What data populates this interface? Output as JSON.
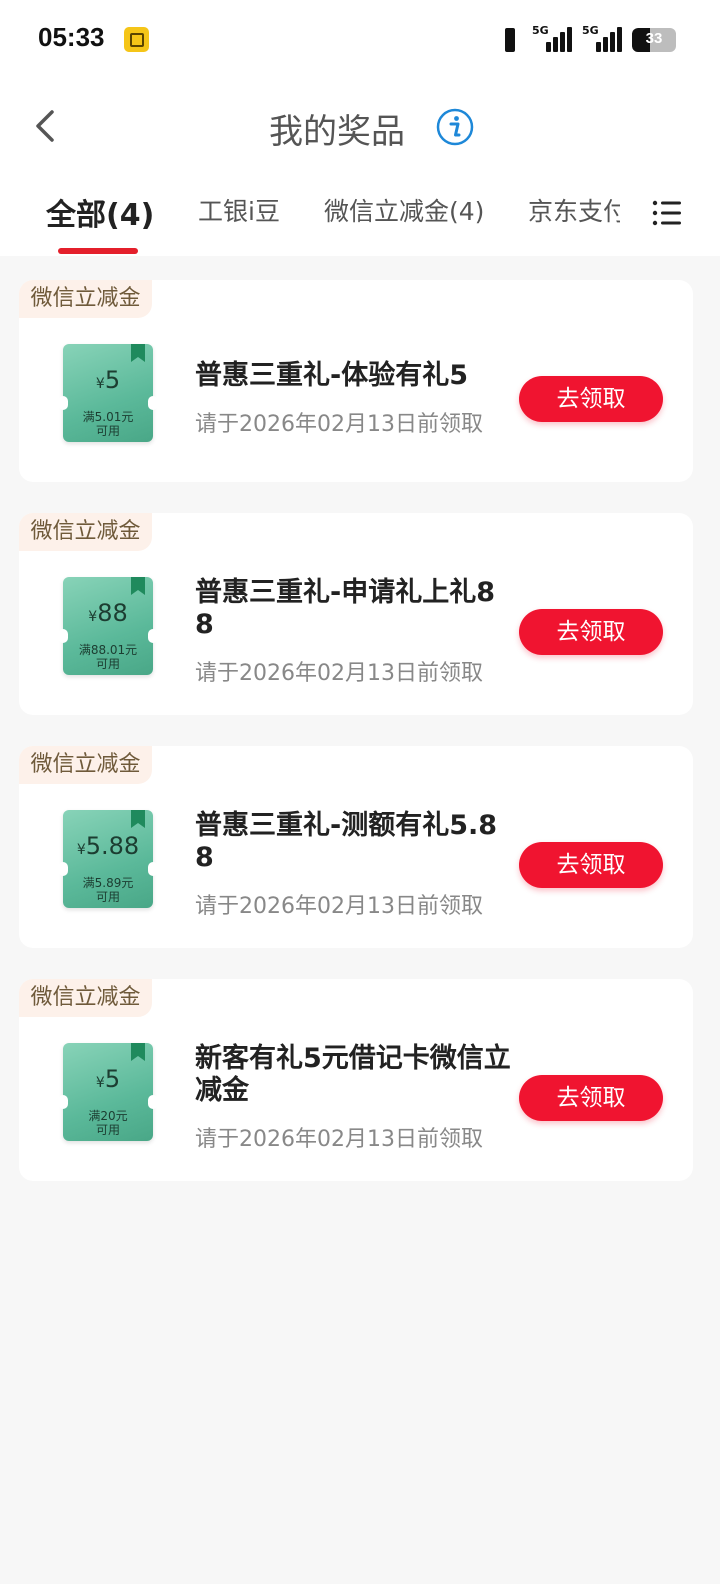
{
  "status_bar": {
    "time": "05:33",
    "network_1": "5G",
    "network_2": "5G",
    "battery_level": "33"
  },
  "header": {
    "title": "我的奖品"
  },
  "tabs": [
    {
      "label": "全部(4)",
      "active": true
    },
    {
      "label": "工银i豆",
      "active": false
    },
    {
      "label": "微信立减金(4)",
      "active": false
    },
    {
      "label": "京东支付",
      "active": false
    }
  ],
  "prizes": [
    {
      "tag": "微信立减金",
      "currency": "¥",
      "amount": "5",
      "condition_line1": "满5.01元",
      "condition_line2": "可用",
      "name": "普惠三重礼-体验有礼5",
      "deadline": "请于2026年02月13日前领取",
      "button": "去领取"
    },
    {
      "tag": "微信立减金",
      "currency": "¥",
      "amount": "88",
      "condition_line1": "满88.01元",
      "condition_line2": "可用",
      "name": "普惠三重礼-申请礼上礼88",
      "deadline": "请于2026年02月13日前领取",
      "button": "去领取"
    },
    {
      "tag": "微信立减金",
      "currency": "¥",
      "amount": "5.88",
      "condition_line1": "满5.89元",
      "condition_line2": "可用",
      "name": "普惠三重礼-测额有礼5.88",
      "deadline": "请于2026年02月13日前领取",
      "button": "去领取"
    },
    {
      "tag": "微信立减金",
      "currency": "¥",
      "amount": "5",
      "condition_line1": "满20元",
      "condition_line2": "可用",
      "name": "新客有礼5元借记卡微信立减金",
      "deadline": "请于2026年02月13日前领取",
      "button": "去领取"
    }
  ],
  "colors": {
    "accent": "#e41f2b",
    "button": "#f01430",
    "coupon": "#5bb99a",
    "info": "#1e88d8"
  }
}
